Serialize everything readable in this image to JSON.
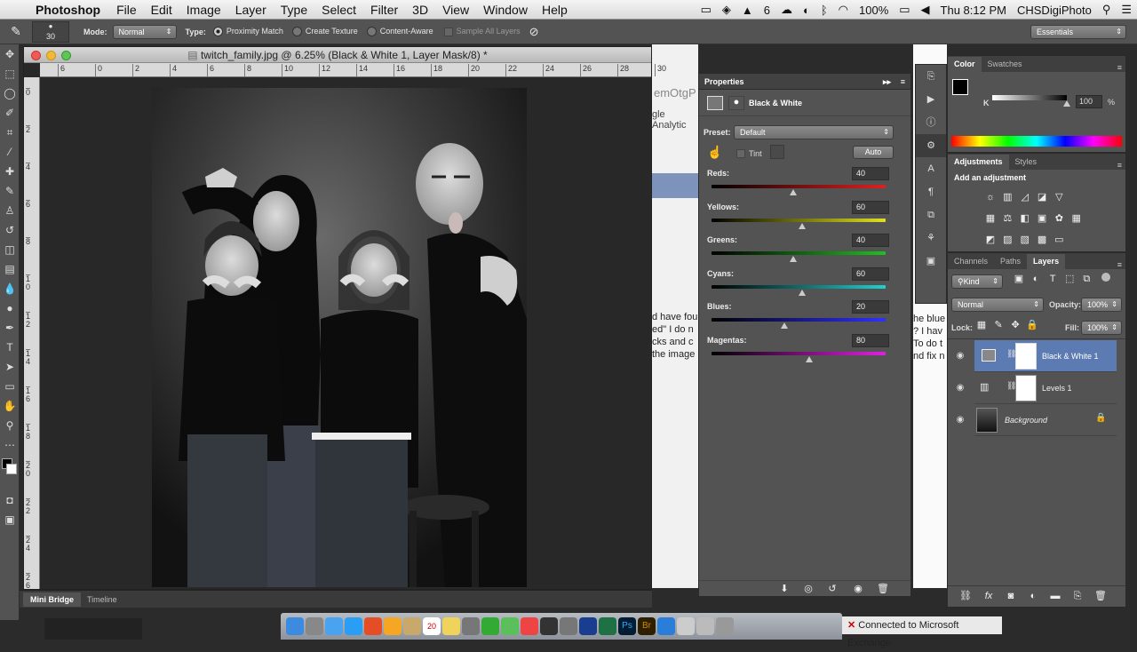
{
  "menubar": {
    "app_name": "Photoshop",
    "items": [
      "File",
      "Edit",
      "Image",
      "Layer",
      "Type",
      "Select",
      "Filter",
      "3D",
      "View",
      "Window",
      "Help"
    ],
    "status": {
      "badge_count": "6",
      "battery": "100%",
      "clock": "Thu 8:12 PM",
      "user": "CHSDigiPhoto"
    }
  },
  "options_bar": {
    "brush_size": "30",
    "mode_label": "Mode:",
    "mode_value": "Normal",
    "type_label": "Type:",
    "type_options": [
      "Proximity Match",
      "Create Texture",
      "Content-Aware"
    ],
    "sample_all_layers": "Sample All Layers",
    "workspace": "Essentials"
  },
  "document": {
    "title": "twitch_family.jpg @ 6.25% (Black & White 1, Layer Mask/8) *",
    "ruler_h_ticks": [
      "6",
      "0",
      "2",
      "4",
      "6",
      "8",
      "10",
      "12",
      "14",
      "16",
      "18",
      "20",
      "22",
      "24",
      "26",
      "28",
      "30"
    ],
    "ruler_v_ticks": [
      "0",
      "2",
      "4",
      "6",
      "8",
      "1\n0",
      "1\n2",
      "1\n4",
      "1\n6",
      "1\n8",
      "2\n0",
      "2\n2",
      "2\n4",
      "2\n6"
    ]
  },
  "bottom_tabs": [
    "Mini Bridge",
    "Timeline"
  ],
  "properties": {
    "title": "Properties",
    "adjustment": "Black & White",
    "preset_label": "Preset:",
    "preset_value": "Default",
    "tint_label": "Tint",
    "auto_label": "Auto",
    "sliders": [
      {
        "label": "Reds:",
        "value": "40",
        "pos": 0.47
      },
      {
        "label": "Yellows:",
        "value": "60",
        "pos": 0.52
      },
      {
        "label": "Greens:",
        "value": "40",
        "pos": 0.47
      },
      {
        "label": "Cyans:",
        "value": "60",
        "pos": 0.52
      },
      {
        "label": "Blues:",
        "value": "20",
        "pos": 0.42
      },
      {
        "label": "Magentas:",
        "value": "80",
        "pos": 0.56
      }
    ]
  },
  "color_panel": {
    "tabs": [
      "Color",
      "Swatches"
    ],
    "channel": "K",
    "value": "100",
    "unit": "%"
  },
  "adjustments_panel": {
    "tabs": [
      "Adjustments",
      "Styles"
    ],
    "heading": "Add an adjustment"
  },
  "layers_panel": {
    "tabs": [
      "Channels",
      "Paths",
      "Layers"
    ],
    "filter_kind": "Kind",
    "blend_mode": "Normal",
    "opacity_label": "Opacity:",
    "opacity_value": "100%",
    "lock_label": "Lock:",
    "fill_label": "Fill:",
    "fill_value": "100%",
    "layers": [
      {
        "name": "Black & White 1",
        "selected": true
      },
      {
        "name": "Levels 1",
        "selected": false
      },
      {
        "name": "Background",
        "selected": false
      }
    ]
  },
  "background_page": {
    "left_fragments": [
      "emOtgP",
      "gle Analytic",
      "d have fou",
      "ed\"  I do n",
      "cks and c",
      "the image"
    ],
    "right_fragments": [
      "he blue",
      "?  I hav",
      "To do t",
      "nd fix n"
    ]
  },
  "notification": "Connected to Microsoft Exchange",
  "dock_badge": "20",
  "colors": {
    "accent": "#5c7bb3",
    "panel": "#535353"
  }
}
